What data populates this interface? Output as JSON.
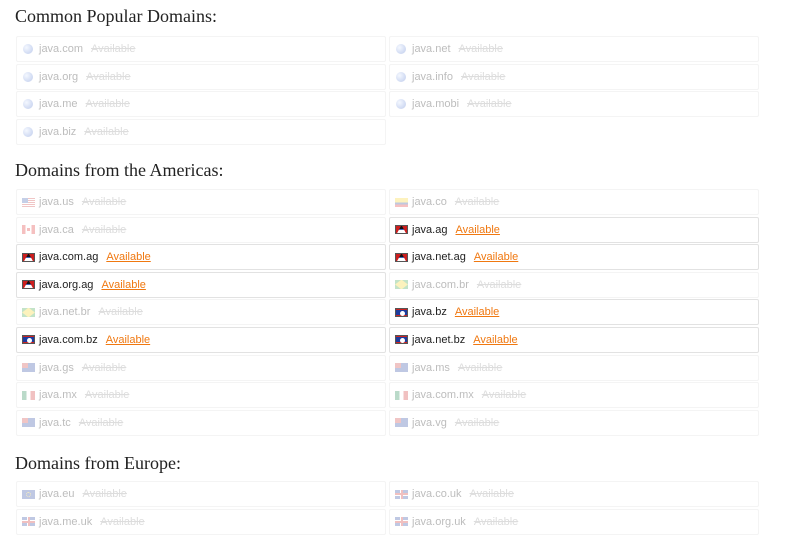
{
  "sections": [
    {
      "title": "Common Popular Domains:",
      "rows": [
        [
          {
            "name": "java.com",
            "status": "Available",
            "icon": "globe-icon",
            "active": false
          },
          {
            "name": "java.net",
            "status": "Available",
            "icon": "globe-icon",
            "active": false
          }
        ],
        [
          {
            "name": "java.org",
            "status": "Available",
            "icon": "globe-icon",
            "active": false
          },
          {
            "name": "java.info",
            "status": "Available",
            "icon": "globe-icon",
            "active": false
          }
        ],
        [
          {
            "name": "java.me",
            "status": "Available",
            "icon": "globe-icon",
            "active": false
          },
          {
            "name": "java.mobi",
            "status": "Available",
            "icon": "globe-icon",
            "active": false
          }
        ],
        [
          {
            "name": "java.biz",
            "status": "Available",
            "icon": "globe-icon",
            "active": false
          },
          null
        ]
      ]
    },
    {
      "title": "Domains from the Americas:",
      "rows": [
        [
          {
            "name": "java.us",
            "status": "Available",
            "icon": "us-flag-icon",
            "active": false
          },
          {
            "name": "java.co",
            "status": "Available",
            "icon": "co-flag-icon",
            "active": false
          }
        ],
        [
          {
            "name": "java.ca",
            "status": "Available",
            "icon": "ca-flag-icon",
            "active": false
          },
          {
            "name": "java.ag",
            "status": "Available",
            "icon": "ag-flag-icon",
            "active": true
          }
        ],
        [
          {
            "name": "java.com.ag",
            "status": "Available",
            "icon": "ag-flag-icon",
            "active": true
          },
          {
            "name": "java.net.ag",
            "status": "Available",
            "icon": "ag-flag-icon",
            "active": true
          }
        ],
        [
          {
            "name": "java.org.ag",
            "status": "Available",
            "icon": "ag-flag-icon",
            "active": true
          },
          {
            "name": "java.com.br",
            "status": "Available",
            "icon": "br-flag-icon",
            "active": false
          }
        ],
        [
          {
            "name": "java.net.br",
            "status": "Available",
            "icon": "br-flag-icon",
            "active": false
          },
          {
            "name": "java.bz",
            "status": "Available",
            "icon": "bz-flag-icon",
            "active": true
          }
        ],
        [
          {
            "name": "java.com.bz",
            "status": "Available",
            "icon": "bz-flag-icon",
            "active": true
          },
          {
            "name": "java.net.bz",
            "status": "Available",
            "icon": "bz-flag-icon",
            "active": true
          }
        ],
        [
          {
            "name": "java.gs",
            "status": "Available",
            "icon": "gs-flag-icon",
            "active": false
          },
          {
            "name": "java.ms",
            "status": "Available",
            "icon": "ms-flag-icon",
            "active": false
          }
        ],
        [
          {
            "name": "java.mx",
            "status": "Available",
            "icon": "mx-flag-icon",
            "active": false
          },
          {
            "name": "java.com.mx",
            "status": "Available",
            "icon": "mx-flag-icon",
            "active": false
          }
        ],
        [
          {
            "name": "java.tc",
            "status": "Available",
            "icon": "tc-flag-icon",
            "active": false
          },
          {
            "name": "java.vg",
            "status": "Available",
            "icon": "vg-flag-icon",
            "active": false
          }
        ]
      ]
    },
    {
      "title": "Domains from Europe:",
      "rows": [
        [
          {
            "name": "java.eu",
            "status": "Available",
            "icon": "eu-flag-icon",
            "active": false
          },
          {
            "name": "java.co.uk",
            "status": "Available",
            "icon": "uk-flag-icon",
            "active": false
          }
        ],
        [
          {
            "name": "java.me.uk",
            "status": "Available",
            "icon": "uk-flag-icon",
            "active": false
          },
          {
            "name": "java.org.uk",
            "status": "Available",
            "icon": "uk-flag-icon",
            "active": false
          }
        ]
      ]
    }
  ],
  "colors": {
    "available_link": "#f07810",
    "dim_text": "#bdbdbd",
    "active_text": "#222222"
  }
}
